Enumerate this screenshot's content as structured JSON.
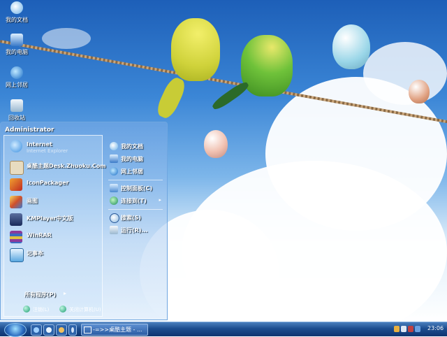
{
  "desktop": {
    "icons": [
      {
        "label": "我的文档",
        "icon": "my-documents-icon"
      },
      {
        "label": "我的电脑",
        "icon": "my-computer-icon"
      },
      {
        "label": "网上邻居",
        "icon": "network-places-icon"
      },
      {
        "label": "回收站",
        "icon": "recycle-bin-icon"
      }
    ]
  },
  "start_menu": {
    "user": "Administrator",
    "programs": [
      {
        "name": "Internet",
        "sub": "Internet Explorer",
        "icon": "internet-explorer-icon",
        "color": "#3a8fe0"
      },
      {
        "name": "桌酷主题Desk.Zhuoku.Com",
        "sub": "",
        "icon": "zhuoku-theme-icon",
        "color": "#c8b48a"
      },
      {
        "name": "IconPackager",
        "sub": "",
        "icon": "iconpackager-icon",
        "color": "#d0502a"
      },
      {
        "name": "画图",
        "sub": "",
        "icon": "paint-icon",
        "color": "#e6b93a"
      },
      {
        "name": "KMPlayer中文版",
        "sub": "",
        "icon": "kmplayer-icon",
        "color": "#2a3f7a"
      },
      {
        "name": "WinRAR",
        "sub": "",
        "icon": "winrar-icon",
        "color": "#8a3a9a"
      },
      {
        "name": "记事本",
        "sub": "",
        "icon": "notepad-icon",
        "color": "#5aa8e0"
      }
    ],
    "all_programs": "所有程序(P)",
    "places": [
      {
        "name": "我的文档",
        "icon": "my-documents-icon",
        "arrow": ""
      },
      {
        "name": "我的电脑",
        "icon": "my-computer-icon",
        "arrow": ""
      },
      {
        "name": "网上邻居",
        "icon": "network-places-icon",
        "arrow": ""
      },
      {
        "name": "控制面板(C)",
        "icon": "control-panel-icon",
        "arrow": ""
      },
      {
        "name": "连接到(T)",
        "icon": "connect-to-icon",
        "arrow": "▸"
      },
      {
        "name": "搜索(S)",
        "icon": "search-icon",
        "arrow": ""
      },
      {
        "name": "运行(R)...",
        "icon": "run-icon",
        "arrow": ""
      }
    ],
    "logoff": "注销(L)",
    "shutdown": "关闭计算机(U)"
  },
  "taskbar": {
    "task_label": "-=>>桌酷主题 - ...",
    "clock": "23:06",
    "quick_launch": [
      "show-desktop-icon",
      "media-player-icon",
      "browser-icon"
    ],
    "tray": [
      "tray-shield-icon",
      "tray-volume-icon",
      "tray-network-icon",
      "tray-app-icon"
    ]
  }
}
